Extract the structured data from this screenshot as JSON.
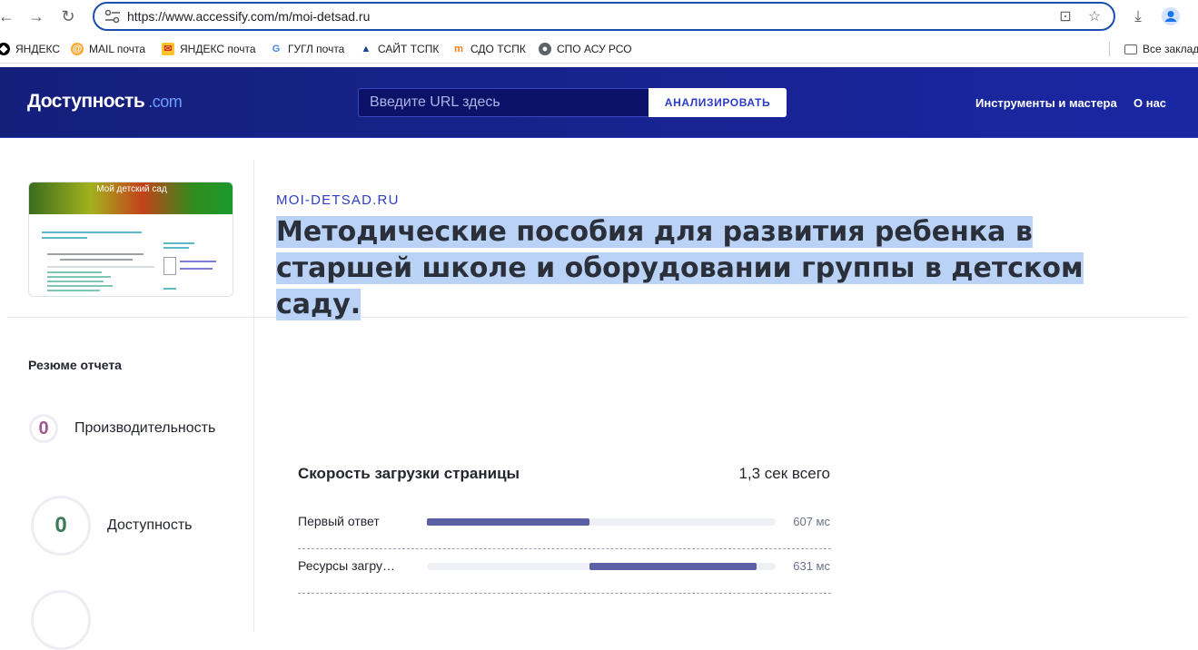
{
  "browser": {
    "url": "https://www.accessify.com/m/moi-detsad.ru",
    "bookmarks": [
      {
        "label": "ЯНДЕКС",
        "icon": "yandex-icon"
      },
      {
        "label": "MAIL почта",
        "icon": "mail-icon"
      },
      {
        "label": "ЯНДЕКС почта",
        "icon": "envelope-icon"
      },
      {
        "label": "ГУГЛ почта",
        "icon": "google-icon"
      },
      {
        "label": "САЙТ ТСПК",
        "icon": "triangle-logo-icon"
      },
      {
        "label": "СДО ТСПК",
        "icon": "moodle-icon"
      },
      {
        "label": "СПО АСУ РСО",
        "icon": "globe-icon"
      }
    ],
    "all_bookmarks": "Все заклад"
  },
  "header": {
    "logo_main": "Доступность",
    "logo_suffix": ".com",
    "url_placeholder": "Введите URL здесь",
    "analyze_label": "АНАЛИЗИРОВАТЬ",
    "nav_tools": "Инструменты и мастера",
    "nav_about": "О нас"
  },
  "report": {
    "thumbnail_title": "Мой детский сад",
    "domain": "MOI-DETSAD.RU",
    "title": "Методические пособия для развития ребенка в старшей школе и оборудовании группы в детском саду."
  },
  "sidebar": {
    "summary_title": "Резюме отчета",
    "scores": [
      {
        "value": "0",
        "label": "Производительность",
        "color": "#a3568f"
      },
      {
        "value": "0",
        "label": "Доступность",
        "color": "#3d7a56"
      }
    ]
  },
  "speed": {
    "title": "Скорость загрузки страницы",
    "total": "1,3 сек всего",
    "rows": [
      {
        "label": "Первый ответ",
        "value": "607 мс",
        "start": 0.0,
        "end": 0.465
      },
      {
        "label": "Ресурсы загру…",
        "value": "631 мс",
        "start": 0.465,
        "end": 0.945
      }
    ]
  },
  "colors": {
    "header_bg": "#1a27a3",
    "accent": "#2d3cc1",
    "bar_fill": "#5b5fa3"
  }
}
